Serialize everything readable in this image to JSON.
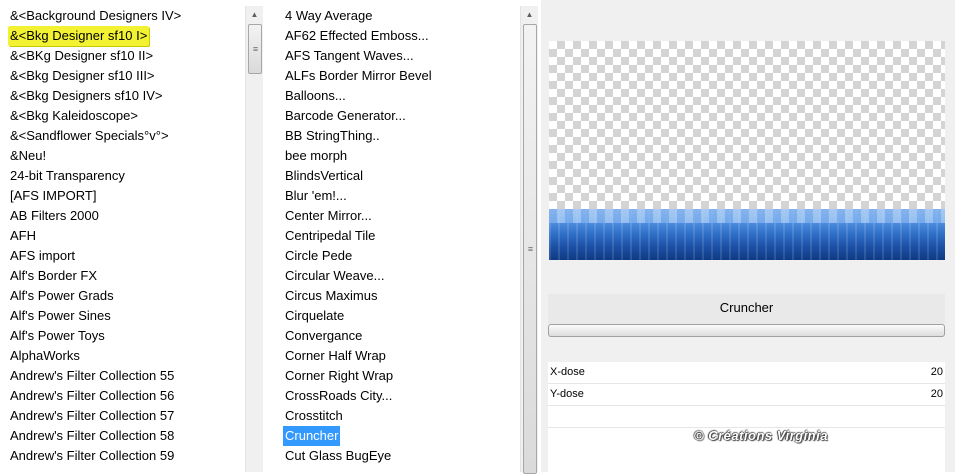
{
  "categories": [
    "&<Background Designers IV>",
    "&<Bkg Designer sf10 I>",
    "&<BKg Designer sf10 II>",
    "&<Bkg Designer sf10 III>",
    "&<Bkg Designers sf10 IV>",
    "&<Bkg Kaleidoscope>",
    "&<Sandflower Specials°v°>",
    "&Neu!",
    "24-bit Transparency",
    "[AFS IMPORT]",
    "AB Filters 2000",
    "AFH",
    "AFS import",
    "Alf's Border FX",
    "Alf's Power Grads",
    "Alf's Power Sines",
    "Alf's Power Toys",
    "AlphaWorks",
    "Andrew's Filter Collection 55",
    "Andrew's Filter Collection 56",
    "Andrew's Filter Collection 57",
    "Andrew's Filter Collection 58",
    "Andrew's Filter Collection 59"
  ],
  "selected_category_index": 1,
  "filters": [
    "4 Way Average",
    "AF62 Effected Emboss...",
    "AFS Tangent Waves...",
    "ALFs Border Mirror Bevel",
    "Balloons...",
    "Barcode Generator...",
    "BB StringThing..",
    "bee morph",
    "BlindsVertical",
    "Blur 'em!...",
    "Center Mirror...",
    "Centripedal Tile",
    "Circle Pede",
    "Circular Weave...",
    "Circus Maximus",
    "Cirquelate",
    "Convergance",
    "Corner Half Wrap",
    "Corner Right Wrap",
    "CrossRoads City...",
    "Crosstitch",
    "Cruncher",
    "Cut Glass  BugEye"
  ],
  "selected_filter_index": 21,
  "filter_title": "Cruncher",
  "params": [
    {
      "name": "X-dose",
      "value": "20"
    },
    {
      "name": "Y-dose",
      "value": "20"
    }
  ],
  "watermark": "© Créations Virginia",
  "colors": {
    "category_highlight": "#f2f232",
    "filter_highlight": "#3399ff"
  },
  "icons": {
    "scroll_up": "▲",
    "scroll_grip": "≡"
  }
}
